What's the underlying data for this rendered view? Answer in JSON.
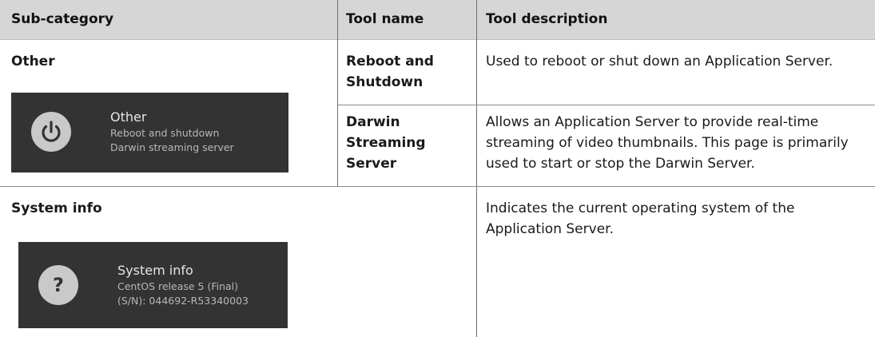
{
  "table": {
    "headers": {
      "subcategory": "Sub-category",
      "tool_name": "Tool name",
      "tool_description": "Tool description"
    },
    "rows": [
      {
        "subcategory": "Other",
        "tools": [
          {
            "name_line1": "Reboot and",
            "name_line2": "Shutdown",
            "description_line1": "Used to reboot or shut down an Application Server."
          },
          {
            "name_line1": "Darwin",
            "name_line2": "Streaming",
            "name_line3": "Server",
            "description_line1": "Allows an Application Server to provide real-time",
            "description_line2": "streaming of video thumbnails. This page is primarily",
            "description_line3": "used to start or stop the Darwin Server."
          }
        ],
        "panel": {
          "icon": "power-icon",
          "title": "Other",
          "line1": "Reboot and shutdown",
          "line2": "Darwin streaming server"
        }
      },
      {
        "subcategory": "System info",
        "description_line1": "Indicates the current operating system of the",
        "description_line2": "Application Server.",
        "panel": {
          "icon": "question-icon",
          "title": "System info",
          "line1": "CentOS release 5 (Final)",
          "line2": "(S/N): 044692-R53340003"
        }
      }
    ]
  },
  "colors": {
    "header_background": "#d6d6d6",
    "panel_background": "#333333",
    "icon_circle": "#c9c9c9"
  }
}
